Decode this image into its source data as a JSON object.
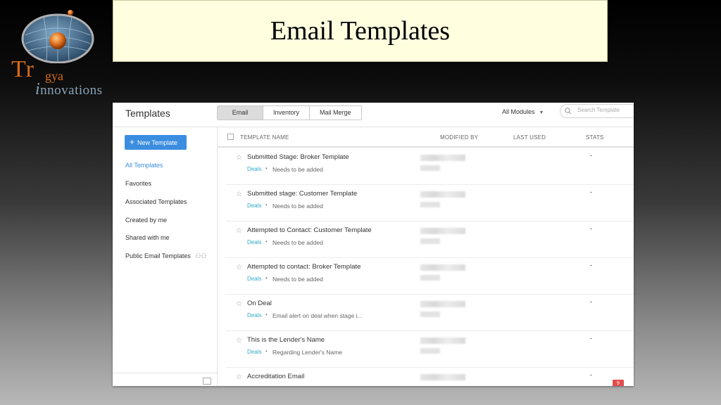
{
  "slide": {
    "title": "Email Templates",
    "logo": {
      "line1": "Tr",
      "line1b": "gya",
      "line2": "nnovations"
    }
  },
  "app": {
    "title": "Templates",
    "tabs": [
      {
        "label": "Email",
        "active": true
      },
      {
        "label": "Inventory",
        "active": false
      },
      {
        "label": "Mail Merge",
        "active": false
      }
    ],
    "modules_label": "All Modules",
    "search_placeholder": "Search Template",
    "new_button": "New Template",
    "sidebar_items": [
      {
        "label": "All Templates",
        "active": true
      },
      {
        "label": "Favorites"
      },
      {
        "label": "Associated Templates"
      },
      {
        "label": "Created by me"
      },
      {
        "label": "Shared with me"
      },
      {
        "label": "Public Email Templates"
      }
    ],
    "columns": [
      "TEMPLATE NAME",
      "MODIFIED BY",
      "LAST USED",
      "STATS"
    ],
    "rows": [
      {
        "name": "Submitted Stage: Broker Template",
        "module": "Deals",
        "desc": "Needs to be added",
        "stats": "-"
      },
      {
        "name": "Submitted stage: Customer Template",
        "module": "Deals",
        "desc": "Needs to be added",
        "stats": "-"
      },
      {
        "name": "Attempted to Contact: Customer Template",
        "module": "Deals",
        "desc": "Needs to be added",
        "stats": "-"
      },
      {
        "name": "Attempted to contact: Broker Template",
        "module": "Deals",
        "desc": "Needs to be added",
        "stats": "-"
      },
      {
        "name": "On Deal",
        "module": "Deals",
        "desc": "Email alert on deal when stage i...",
        "stats": "-"
      },
      {
        "name": "This is the Lender's Name",
        "module": "Deals",
        "desc": "Regarding Lender's Name",
        "stats": "-"
      },
      {
        "name": "Accreditation Email",
        "module": "",
        "desc": "",
        "stats": "-"
      }
    ],
    "badge_count": "9"
  },
  "colors": {
    "accent": "#3b8de0",
    "module_tag": "#2eaac7",
    "badge": "#e34b4b",
    "title_bg": "#ffffe0"
  }
}
